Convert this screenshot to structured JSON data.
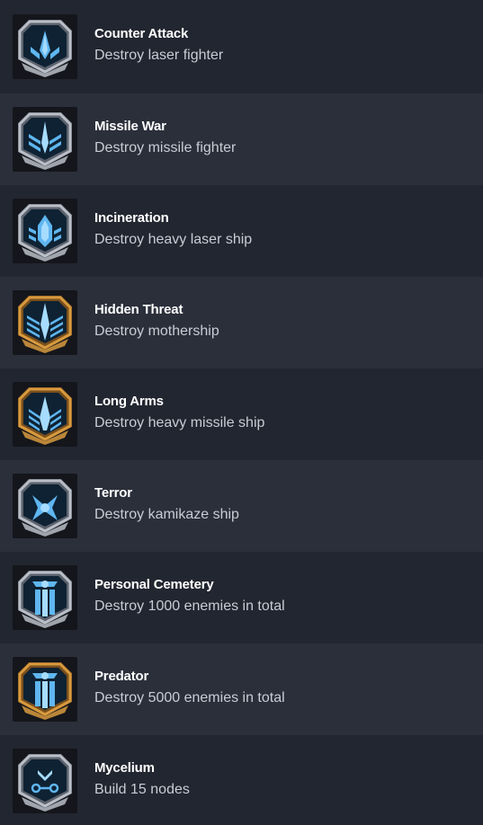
{
  "achievements": [
    {
      "title": "Counter Attack",
      "description": "Destroy laser fighter",
      "frame": "silver",
      "emblem": "laser-fighter-icon"
    },
    {
      "title": "Missile War",
      "description": "Destroy missile fighter",
      "frame": "silver",
      "emblem": "missile-fighter-icon"
    },
    {
      "title": "Incineration",
      "description": "Destroy heavy laser ship",
      "frame": "silver",
      "emblem": "heavy-laser-ship-icon"
    },
    {
      "title": "Hidden Threat",
      "description": "Destroy mothership",
      "frame": "gold",
      "emblem": "mothership-icon"
    },
    {
      "title": "Long Arms",
      "description": "Destroy heavy missile ship",
      "frame": "gold",
      "emblem": "heavy-missile-ship-icon"
    },
    {
      "title": "Terror",
      "description": "Destroy kamikaze ship",
      "frame": "silver",
      "emblem": "kamikaze-ship-icon"
    },
    {
      "title": "Personal Cemetery",
      "description": "Destroy 1000 enemies in total",
      "frame": "silver",
      "emblem": "skull-banner-icon"
    },
    {
      "title": "Predator",
      "description": "Destroy 5000 enemies in total",
      "frame": "gold",
      "emblem": "skull-banner-icon"
    },
    {
      "title": "Mycelium",
      "description": "Build 15 nodes",
      "frame": "silver",
      "emblem": "nodes-icon"
    }
  ],
  "colors": {
    "silver": "#b9bec7",
    "silver_dark": "#5d636e",
    "gold": "#d79a3e",
    "gold_dark": "#7a4f1c",
    "emblem": "#5fb6f0",
    "emblem_light": "#a6dcff",
    "badge_bg": "#0e2233"
  }
}
